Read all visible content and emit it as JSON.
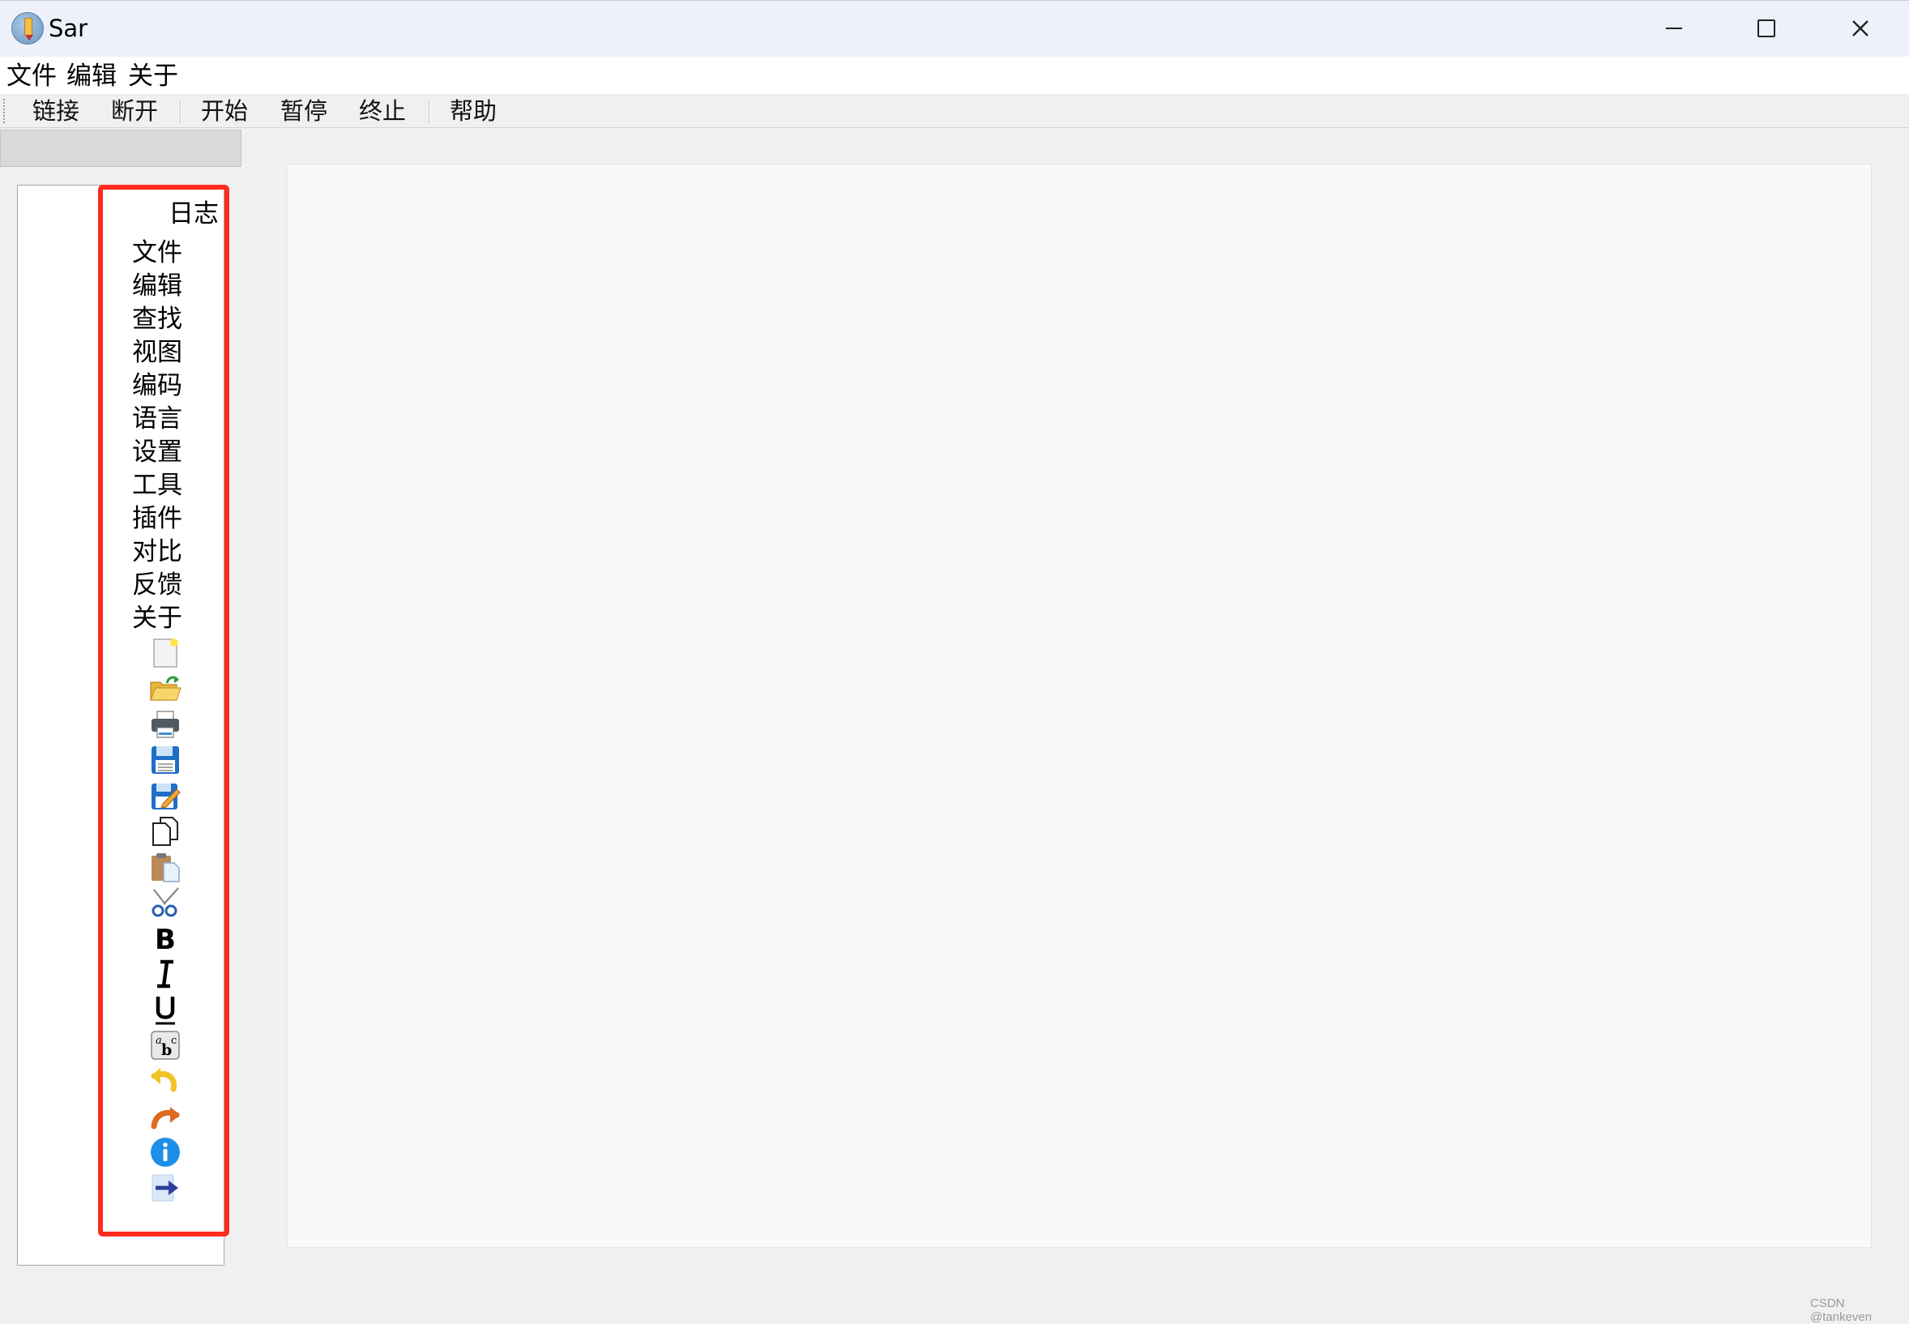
{
  "window": {
    "title": "Sar"
  },
  "menubar": {
    "items": [
      "文件",
      "编辑",
      "关于"
    ]
  },
  "toolbar": {
    "buttons": [
      "链接",
      "断开",
      "开始",
      "暂停",
      "终止",
      "帮助"
    ]
  },
  "tree": {
    "root": "日志",
    "items": [
      "文件",
      "编辑",
      "查找",
      "视图",
      "编码",
      "语言",
      "设置",
      "工具",
      "插件",
      "对比",
      "反馈",
      "关于"
    ],
    "icons": [
      "new-file-icon",
      "open-folder-icon",
      "print-icon",
      "save-icon",
      "save-as-icon",
      "copy-icon",
      "paste-icon",
      "cut-icon",
      "bold-icon",
      "italic-icon",
      "underline-icon",
      "spell-check-icon",
      "undo-icon",
      "redo-icon",
      "info-icon",
      "exit-icon"
    ]
  },
  "footer": {
    "watermark": "CSDN @tankeven"
  }
}
